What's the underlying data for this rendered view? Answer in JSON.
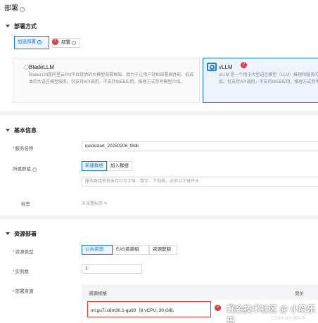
{
  "page": {
    "title": "部署"
  },
  "deploy_method": {
    "section_title": "部署方式",
    "tabs": [
      {
        "label": "加速部署",
        "active": true
      },
      {
        "label": "部署",
        "active": false
      }
    ],
    "badges": [
      "1",
      "2"
    ],
    "options": [
      {
        "name": "BladeLLM",
        "selected": false,
        "desc": "BladeLLM是阿里云PAI平台提供的大模型部署框架，致力于让用户轻松部署高性能、低成本的大语言模型服务。仅支持API调用，不支持WEB应用，推理方式参考模型介绍。"
      },
      {
        "name": "vLLM",
        "selected": true,
        "desc": "vLLM 是一个用于大型语言模型（LLM）推理和服务的库。仅支持API调用，不支持WEB应用，推理方式参考模型介绍。"
      }
    ]
  },
  "basic_info": {
    "section_title": "基本信息",
    "service_name_label": "服务名称",
    "service_name_value": "quickstart_20250206_t8dk",
    "group_label": "所属群组",
    "group_buttons": [
      {
        "label": "新建群组",
        "active": true
      },
      {
        "label": "加入群组",
        "active": false
      }
    ],
    "group_placeholder": "服务群组名称支持小写字母、数字、下划线，必须以字母开头",
    "tag_label": "标签",
    "tag_value": "未设置标签"
  },
  "resources": {
    "section_title": "资源部署",
    "type_label": "资源类型",
    "type_buttons": [
      {
        "label": "公共资源",
        "active": true
      },
      {
        "label": "EAS资源组",
        "active": false
      },
      {
        "label": "资源配额",
        "active": false
      }
    ],
    "instances_label": "实例数",
    "instances_value": "1",
    "deploy_res_label": "部署资源",
    "table_headers": [
      "资源规格",
      "竞价"
    ],
    "spec_value": "ml.gu7i.c8m30.1-gu30（8 vCPU, 30 GiB,"
  },
  "watermark": {
    "main": "掘金技术社区 @ 小隐乐乐",
    "sub": "CSDN @小隐乐乐"
  },
  "colors": {
    "accent": "#1677ff",
    "highlight": "#e23b3b",
    "divider": "#f2f3f5"
  }
}
